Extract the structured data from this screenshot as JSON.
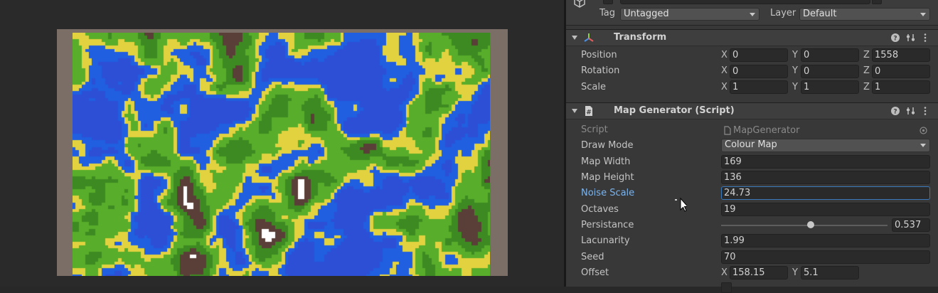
{
  "gameobject": {
    "tag_label": "Tag",
    "tag_value": "Untagged",
    "layer_label": "Layer",
    "layer_value": "Default"
  },
  "transform": {
    "title": "Transform",
    "rows": [
      {
        "label": "Position",
        "x": "0",
        "y": "0",
        "z": "1558"
      },
      {
        "label": "Rotation",
        "x": "0",
        "y": "0",
        "z": "0"
      },
      {
        "label": "Scale",
        "x": "1",
        "y": "1",
        "z": "1"
      }
    ],
    "axis": {
      "x": "X",
      "y": "Y",
      "z": "Z"
    }
  },
  "map_generator": {
    "title": "Map Generator (Script)",
    "script_label": "Script",
    "script_value": "MapGenerator",
    "draw_mode_label": "Draw Mode",
    "draw_mode_value": "Colour Map",
    "map_width_label": "Map Width",
    "map_width_value": "169",
    "map_height_label": "Map Height",
    "map_height_value": "136",
    "noise_scale_label": "Noise Scale",
    "noise_scale_value": "24.73",
    "octaves_label": "Octaves",
    "octaves_value": "19",
    "persistance_label": "Persistance",
    "persistance_value": "0.537",
    "persistance_fraction": 0.537,
    "lacunarity_label": "Lacunarity",
    "lacunarity_value": "1.99",
    "seed_label": "Seed",
    "seed_value": "70",
    "offset_label": "Offset",
    "offset_x": "158.15",
    "offset_y": "5.1"
  },
  "map_preview": {
    "seed": 70,
    "palette": {
      "water": "#1f5fe0",
      "deep_water": "#2c4fd6",
      "sand": "#e3d23f",
      "grass": "#58ad2a",
      "forest": "#3e8a22",
      "rock": "#5a3f38",
      "snow": "#ffffff"
    }
  },
  "icons": {
    "gameobject": "cube-icon",
    "transform": "transform-icon",
    "script": "script-icon",
    "help": "help-icon",
    "presets": "presets-icon",
    "menu": "kebab-menu-icon",
    "object_picker": "object-picker-icon",
    "cursor": "mouse-cursor-icon"
  }
}
